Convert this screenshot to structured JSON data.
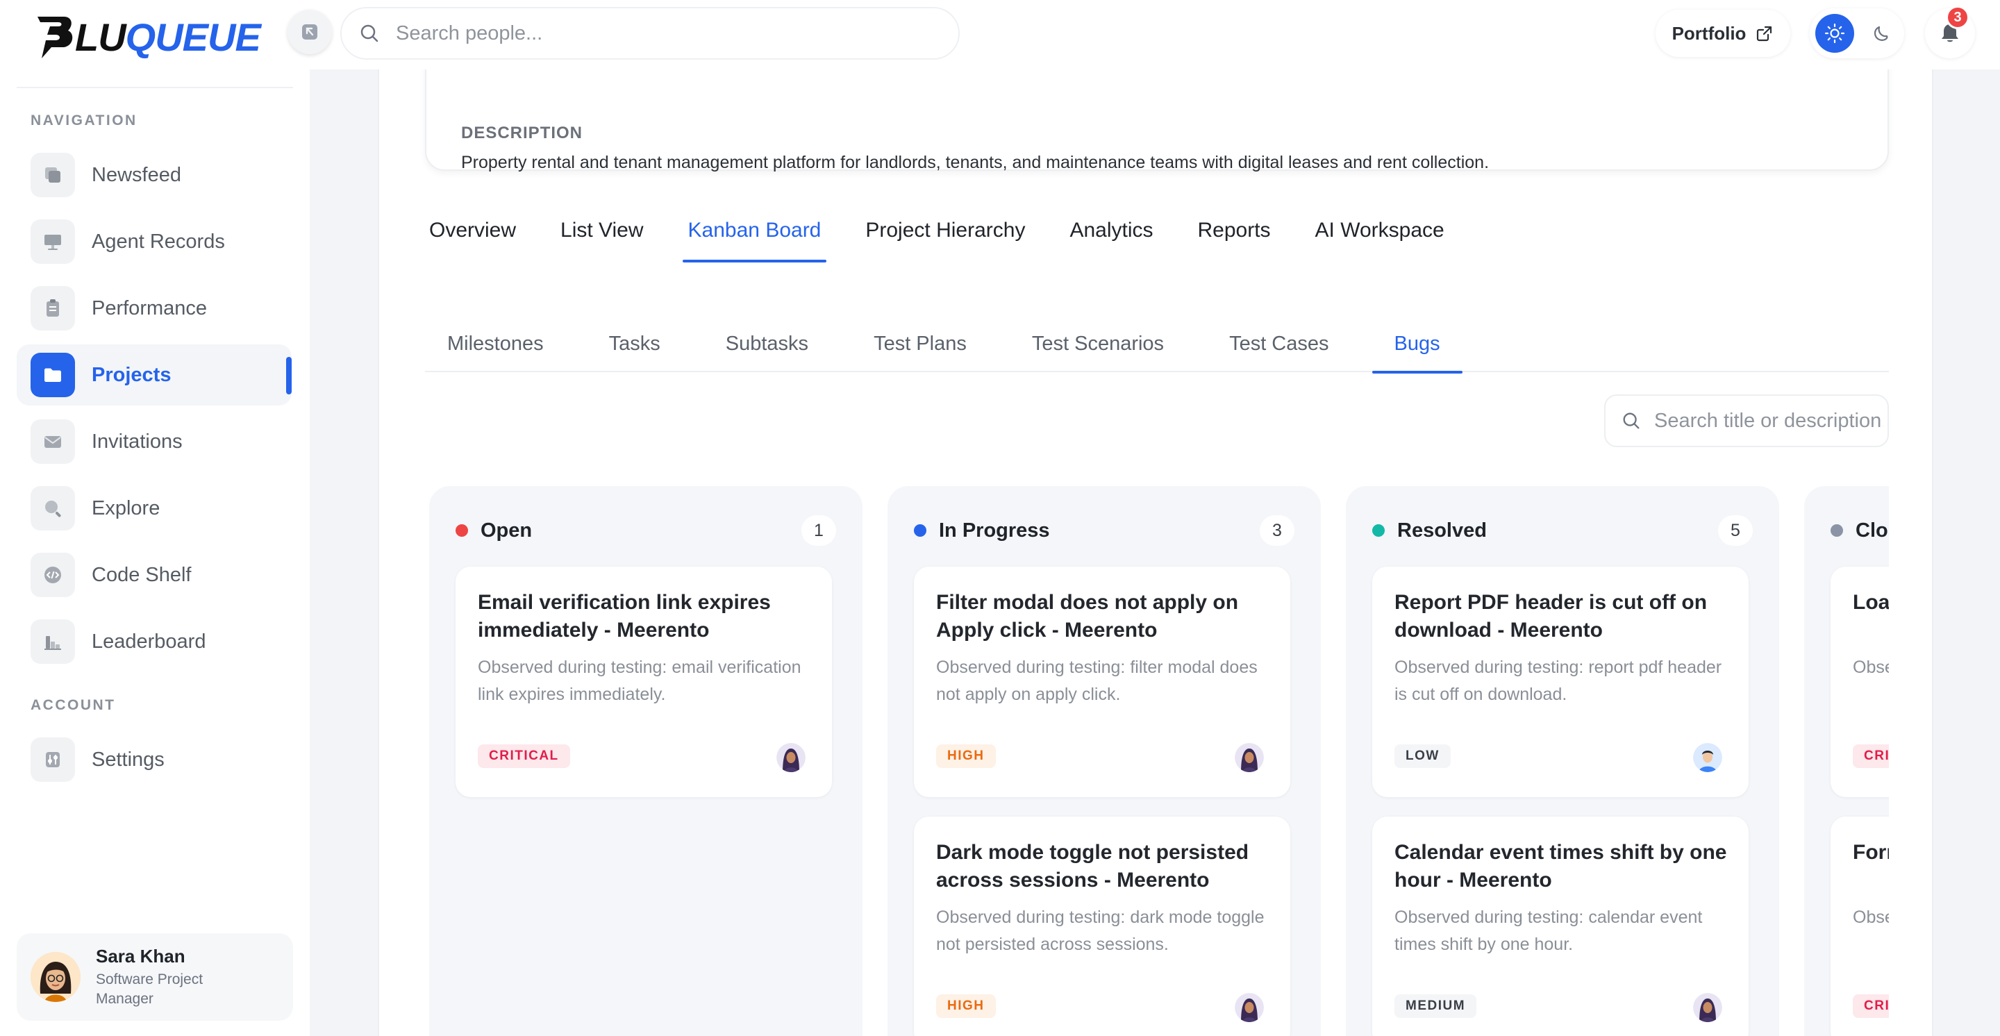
{
  "brand": {
    "name_part1": "LU",
    "name_part2": "QUEUE",
    "accent": "#2563eb"
  },
  "sidebar": {
    "nav_label": "NAVIGATION",
    "account_label": "ACCOUNT",
    "items": [
      {
        "label": "Newsfeed",
        "icon": "newsfeed-icon"
      },
      {
        "label": "Agent Records",
        "icon": "monitor-icon"
      },
      {
        "label": "Performance",
        "icon": "clipboard-icon"
      },
      {
        "label": "Projects",
        "icon": "folder-icon",
        "active": true
      },
      {
        "label": "Invitations",
        "icon": "mail-icon"
      },
      {
        "label": "Explore",
        "icon": "search-icon"
      },
      {
        "label": "Code Shelf",
        "icon": "code-icon"
      },
      {
        "label": "Leaderboard",
        "icon": "bar-chart-icon"
      }
    ],
    "account_items": [
      {
        "label": "Settings",
        "icon": "sliders-icon"
      }
    ],
    "user": {
      "name": "Sara Khan",
      "role": "Software Project Manager"
    }
  },
  "topbar": {
    "search_placeholder": "Search people...",
    "portfolio_label": "Portfolio",
    "notification_count": "3"
  },
  "project": {
    "description_label": "DESCRIPTION",
    "description": "Property rental and tenant management platform for landlords, tenants, and maintenance teams with digital leases and rent collection."
  },
  "main_tabs": [
    {
      "label": "Overview"
    },
    {
      "label": "List View"
    },
    {
      "label": "Kanban Board",
      "active": true
    },
    {
      "label": "Project Hierarchy"
    },
    {
      "label": "Analytics"
    },
    {
      "label": "Reports"
    },
    {
      "label": "AI Workspace"
    }
  ],
  "sub_tabs": [
    {
      "label": "Milestones"
    },
    {
      "label": "Tasks"
    },
    {
      "label": "Subtasks"
    },
    {
      "label": "Test Plans"
    },
    {
      "label": "Test Scenarios"
    },
    {
      "label": "Test Cases"
    },
    {
      "label": "Bugs",
      "active": true
    }
  ],
  "board": {
    "search_placeholder": "Search title or description...",
    "columns": [
      {
        "title": "Open",
        "count": "1",
        "color": "#ef4444",
        "cards": [
          {
            "title": "Email verification link expires immediately - Meerento",
            "description": "Observed during testing: email verification link expires immediately.",
            "severity": "CRITICAL",
            "avatar": "hijab"
          }
        ]
      },
      {
        "title": "In Progress",
        "count": "3",
        "color": "#2563eb",
        "cards": [
          {
            "title": "Filter modal does not apply on Apply click - Meerento",
            "description": "Observed during testing: filter modal does not apply on apply click.",
            "severity": "HIGH",
            "avatar": "hijab"
          },
          {
            "title": "Dark mode toggle not persisted across sessions - Meerento",
            "description": "Observed during testing: dark mode toggle not persisted across sessions.",
            "severity": "HIGH",
            "avatar": "hijab"
          }
        ]
      },
      {
        "title": "Resolved",
        "count": "5",
        "color": "#14b8a6",
        "cards": [
          {
            "title": "Report PDF header is cut off on download - Meerento",
            "description": "Observed during testing: report pdf header is cut off on download.",
            "severity": "LOW",
            "avatar": "man"
          },
          {
            "title": "Calendar event times shift by one hour - Meerento",
            "description": "Observed during testing: calendar event times shift by one hour.",
            "severity": "MEDIUM",
            "avatar": "hijab"
          }
        ]
      },
      {
        "title": "Closed",
        "count": "",
        "color": "#8a94a6",
        "cards": [
          {
            "title": "Loading state",
            "description": "Observed before",
            "severity": "CRITICAL",
            "avatar": "hijab"
          },
          {
            "title": "Form over",
            "description": "Observed valid",
            "severity": "CRITICAL",
            "avatar": "hijab"
          }
        ]
      }
    ]
  }
}
